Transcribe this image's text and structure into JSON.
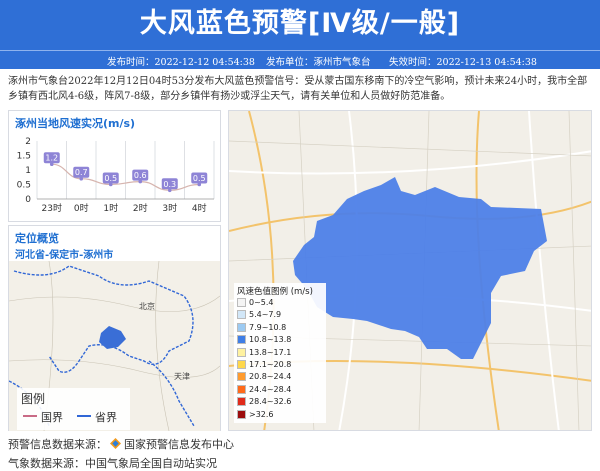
{
  "header": {
    "title": "大风蓝色预警[Ⅳ级/一般]",
    "publish_time": "发布时间：2022-12-12 04:54:38",
    "publisher": "发布单位：涿州市气象台",
    "expire_time": "失效时间：2022-12-13 04:54:38"
  },
  "description": "涿州市气象台2022年12月12日04时53分发布大风蓝色预警信号：受从蒙古国东移南下的冷空气影响，预计未来24小时，我市全部乡镇有西北风4-6级，阵风7-8级，部分乡镇伴有扬沙或浮尘天气，请有关单位和人员做好防范准备。",
  "wind_panel": {
    "title": "涿州当地风速实况(m/s)"
  },
  "chart_data": {
    "type": "line",
    "categories": [
      "23时",
      "0时",
      "1时",
      "2时",
      "3时",
      "4时"
    ],
    "values": [
      1.2,
      0.7,
      0.5,
      0.6,
      0.3,
      0.5
    ],
    "ylim": [
      0,
      2
    ],
    "yticks": [
      "0",
      "0.5",
      "1",
      "1.5",
      "2"
    ],
    "ylabel": "",
    "xlabel": "",
    "grid": "vertical"
  },
  "location_panel": {
    "title": "定位概览",
    "region": "河北省-保定市-涿州市",
    "legend_title": "图例",
    "legend_items": [
      {
        "label": "国界",
        "color": "#c96b86"
      },
      {
        "label": "省界",
        "color": "#3167d6"
      }
    ],
    "place_labels": [
      "北京",
      "天津"
    ]
  },
  "map": {
    "legend_title": "风速色值图例 (m/s)",
    "legend_items": [
      {
        "label": "0~5.4",
        "color": "#f4f4f4"
      },
      {
        "label": "5.4~7.9",
        "color": "#d2e7f8"
      },
      {
        "label": "7.9~10.8",
        "color": "#9ccaf2"
      },
      {
        "label": "10.8~13.8",
        "color": "#3f7ee6"
      },
      {
        "label": "13.8~17.1",
        "color": "#fff2a0"
      },
      {
        "label": "17.1~20.8",
        "color": "#ffd74a"
      },
      {
        "label": "20.8~24.4",
        "color": "#ff9b2e"
      },
      {
        "label": "24.4~28.4",
        "color": "#ff6a1a"
      },
      {
        "label": "28.4~32.6",
        "color": "#e02a1a"
      },
      {
        "label": ">32.6",
        "color": "#9c0d0d"
      }
    ],
    "warning_area_color": "#4d7fe8"
  },
  "footer": {
    "warning_source": "预警信息数据来源：",
    "warning_source_name": "国家预警信息发布中心",
    "weather_source": "气象数据来源：中国气象局全国自动站实况"
  }
}
